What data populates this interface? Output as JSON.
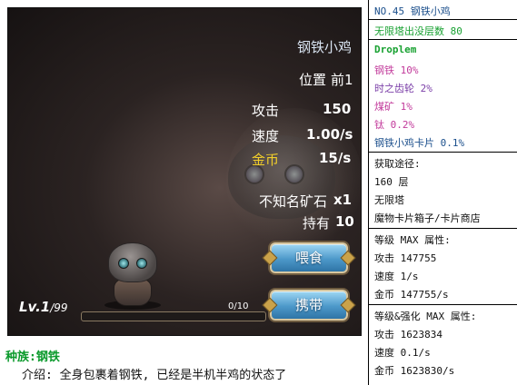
{
  "game": {
    "pet_name": "钢铁小鸡",
    "position_label": "位置",
    "position_value": "前1",
    "stats": [
      {
        "label": "攻击",
        "value": "150"
      },
      {
        "label": "速度",
        "value": "1.00/s"
      },
      {
        "label": "金币",
        "value": "15/s"
      }
    ],
    "ore_label": "不知名矿石",
    "ore_count": "x1",
    "own_label": "持有",
    "own_count": "10",
    "feed_button": "喂食",
    "carry_button": "携带",
    "level": "Lv.1",
    "level_max": "/99",
    "xp_text": "0/10",
    "xp_fraction": 0.0
  },
  "description": {
    "race": "种族:钢铁",
    "intro": "介绍: 全身包裹着钢铁, 已经是半机半鸡的状态了"
  },
  "info": {
    "title": "NO.45 钢铁小鸡",
    "floor": "无限塔出没层数 80",
    "drop_header": "Droplem",
    "drops": [
      {
        "text": "钢铁 10%",
        "color": "#c23a9b"
      },
      {
        "text": "时之齿轮 2%",
        "color": "#7b3fa8"
      },
      {
        "text": "煤矿 1%",
        "color": "#c23a9b"
      },
      {
        "text": "钛 0.2%",
        "color": "#c23a9b"
      },
      {
        "text": "钢铁小鸡卡片 0.1%",
        "color": "#1b4f8c"
      }
    ],
    "obtain_header": "获取途径:",
    "obtain": [
      "160 层",
      "无限塔",
      "魔物卡片箱子/卡片商店"
    ],
    "maxlv_header": "等级 MAX 属性:",
    "maxlv": [
      "攻击 147755",
      "速度 1/s",
      "金币 147755/s"
    ],
    "maxall_header": "等级&强化 MAX 属性:",
    "maxall": [
      "攻击 1623834",
      "速度 0.1/s",
      "金币 1623830/s"
    ]
  }
}
